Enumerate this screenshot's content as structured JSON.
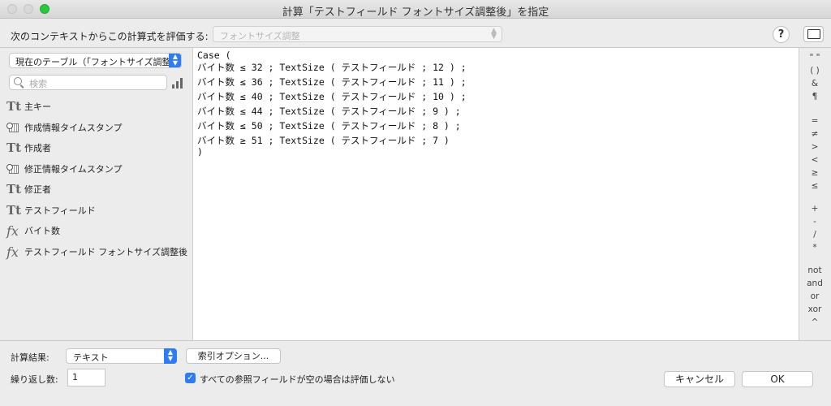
{
  "window": {
    "title": "計算「テストフィールド フォントサイズ調整後」を指定"
  },
  "context": {
    "label": "次のコンテキストからこの計算式を評価する:",
    "selected": "フォントサイズ調整"
  },
  "sidebar": {
    "table_selected": "現在のテーブル（「フォントサイズ調整」）",
    "search_placeholder": "検索",
    "fields": [
      {
        "name": "主キー",
        "type_icon": "text-type-icon"
      },
      {
        "name": "作成情報タイムスタンプ",
        "type_icon": "timestamp-icon"
      },
      {
        "name": "作成者",
        "type_icon": "text-type-icon"
      },
      {
        "name": "修正情報タイムスタンプ",
        "type_icon": "timestamp-icon"
      },
      {
        "name": "修正者",
        "type_icon": "text-type-icon"
      },
      {
        "name": "テストフィールド",
        "type_icon": "text-type-icon"
      },
      {
        "name": "バイト数",
        "type_icon": "calculation-icon"
      },
      {
        "name": "テストフィールド フォントサイズ調整後",
        "type_icon": "calculation-icon"
      }
    ]
  },
  "formula": {
    "lines": [
      "Case (",
      "バイト数 ≤ 32 ; TextSize ( テストフィールド ; 12 ) ;",
      "バイト数 ≤ 36 ; TextSize ( テストフィールド ; 11 ) ;",
      "バイト数 ≤ 40 ; TextSize ( テストフィールド ; 10 ) ;",
      "バイト数 ≤ 44 ; TextSize ( テストフィールド ; 9 ) ;",
      "バイト数 ≤ 50 ; TextSize ( テストフィールド ; 8 ) ;",
      "バイト数 ≥ 51 ; TextSize ( テストフィールド ; 7 )",
      ")"
    ]
  },
  "operators": [
    "\" \"",
    "( )",
    "&",
    "¶",
    "=",
    "≠",
    ">",
    "<",
    "≥",
    "≤",
    "+",
    "-",
    "/",
    "*",
    "not",
    "and",
    "or",
    "xor",
    "^"
  ],
  "bottom": {
    "result_label": "計算結果:",
    "result_type": "テキスト",
    "index_options": "索引オプション...",
    "repeat_label": "繰り返し数:",
    "repeat_value": "1",
    "skip_empty_label": "すべての参照フィールドが空の場合は評価しない",
    "skip_empty_checked": true,
    "cancel": "キャンセル",
    "ok": "OK"
  },
  "colors": {
    "accent": "#2d7cf6",
    "window_bg": "#ececec"
  }
}
